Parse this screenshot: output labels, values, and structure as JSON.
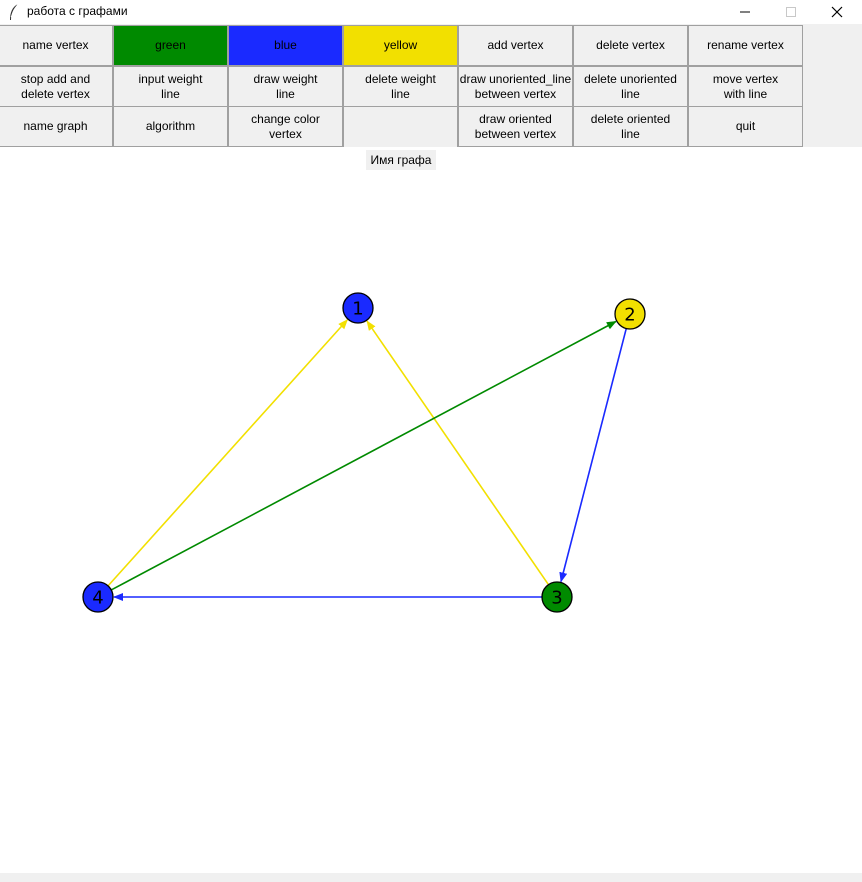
{
  "window": {
    "title": "работа с графами",
    "icon": "feather-icon",
    "controls": [
      "minimize-icon",
      "maximize-icon",
      "close-icon"
    ]
  },
  "toolbar": {
    "buttons": [
      {
        "label": "name vertex",
        "bg": "#f0f0f0"
      },
      {
        "label": "green",
        "bg": "#008a00"
      },
      {
        "label": "blue",
        "bg": "#1a2aff"
      },
      {
        "label": "yellow",
        "bg": "#f2e000"
      },
      {
        "label": "add vertex",
        "bg": "#f0f0f0"
      },
      {
        "label": "delete vertex",
        "bg": "#f0f0f0"
      },
      {
        "label": "rename vertex",
        "bg": "#f0f0f0"
      },
      {
        "label": "stop add and\ndelete vertex",
        "bg": "#f0f0f0"
      },
      {
        "label": "input weight\nline",
        "bg": "#f0f0f0"
      },
      {
        "label": "draw weight\nline",
        "bg": "#f0f0f0"
      },
      {
        "label": "delete weight\nline",
        "bg": "#f0f0f0"
      },
      {
        "label": "draw unoriented_line\nbetween vertex",
        "bg": "#f0f0f0"
      },
      {
        "label": "delete unoriented\nline",
        "bg": "#f0f0f0"
      },
      {
        "label": "move vertex\nwith line",
        "bg": "#f0f0f0"
      },
      {
        "label": "name graph",
        "bg": "#f0f0f0"
      },
      {
        "label": "algorithm",
        "bg": "#f0f0f0"
      },
      {
        "label": "change color\nvertex",
        "bg": "#f0f0f0"
      },
      {
        "label": "",
        "bg": "#f0f0f0"
      },
      {
        "label": "draw oriented\nbetween vertex",
        "bg": "#f0f0f0"
      },
      {
        "label": "delete oriented\nline",
        "bg": "#f0f0f0"
      },
      {
        "label": "quit",
        "bg": "#f0f0f0"
      }
    ]
  },
  "graph_name_label": "Имя графа",
  "colors": {
    "green": "#008a00",
    "blue": "#1a2aff",
    "yellow": "#f2e000"
  },
  "graph": {
    "vertices": [
      {
        "id": "1",
        "color": "#1a2aff"
      },
      {
        "id": "2",
        "color": "#f2e000"
      },
      {
        "id": "3",
        "color": "#008a00"
      },
      {
        "id": "4",
        "color": "#1a2aff"
      }
    ],
    "edges": [
      {
        "from": "4",
        "to": "1",
        "color": "#f2e000",
        "directed": true
      },
      {
        "from": "3",
        "to": "1",
        "color": "#f2e000",
        "directed": true
      },
      {
        "from": "4",
        "to": "2",
        "color": "#008a00",
        "directed": true
      },
      {
        "from": "2",
        "to": "3",
        "color": "#1a2aff",
        "directed": true
      },
      {
        "from": "3",
        "to": "4",
        "color": "#1a2aff",
        "directed": true
      }
    ]
  }
}
